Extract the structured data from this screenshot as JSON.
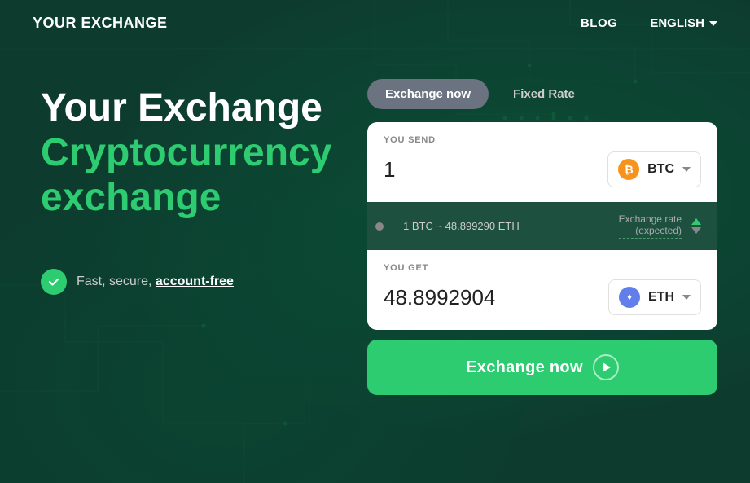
{
  "nav": {
    "logo": "YOUR EXCHANGE",
    "blog_label": "BLOG",
    "language_label": "ENGLISH"
  },
  "hero": {
    "headline_line1": "Your Exchange",
    "headline_line2": "Cryptocurrency",
    "headline_line3": "exchange",
    "tagline": "Fast, secure, ",
    "tagline_link": "account-free"
  },
  "widget": {
    "tab_exchange_now": "Exchange now",
    "tab_fixed_rate": "Fixed Rate",
    "send_label": "YOU SEND",
    "send_amount": "1",
    "send_currency": "BTC",
    "rate_text": "1 BTC ~ 48.899290 ETH",
    "rate_label": "Exchange rate\n(expected)",
    "get_label": "YOU GET",
    "get_amount": "48.8992904",
    "get_currency": "ETH",
    "exchange_btn_label": "Exchange now"
  }
}
